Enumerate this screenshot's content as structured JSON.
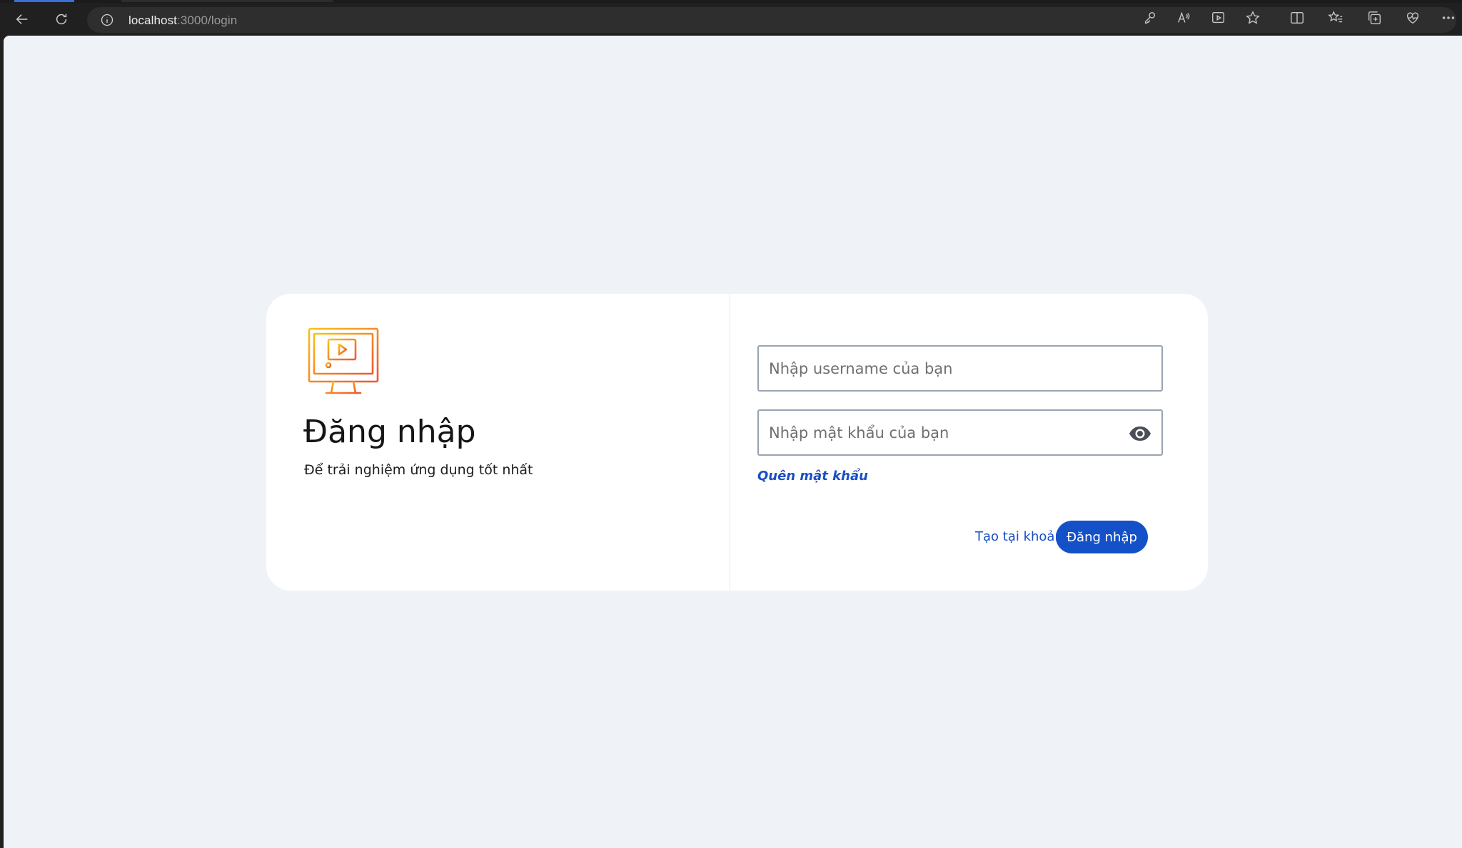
{
  "browser": {
    "url_host": "localhost",
    "url_path": ":3000/login",
    "icons": [
      "back-icon",
      "refresh-icon",
      "site-info-icon",
      "key-icon",
      "read-aloud-icon",
      "app-available-icon",
      "favorite-star-icon",
      "split-screen-icon",
      "favorites-list-icon",
      "collections-icon",
      "browser-essentials-icon",
      "more-menu-icon"
    ]
  },
  "login": {
    "title": "Đăng nhập",
    "subtitle": "Để trải nghiệm ứng dụng tốt nhất",
    "username_placeholder": "Nhập username của bạn",
    "username_value": "",
    "password_placeholder": "Nhập mật khẩu của bạn",
    "password_value": "",
    "forgot_label": "Quên mật khẩu",
    "create_account_label": "Tạo tại khoản",
    "submit_label": "Đăng nhập"
  },
  "colors": {
    "page_bg": "#eff3f8",
    "card_bg": "#ffffff",
    "primary": "#1450c8",
    "logo_gradient_start": "#f9c21b",
    "logo_gradient_end": "#f0552f"
  }
}
